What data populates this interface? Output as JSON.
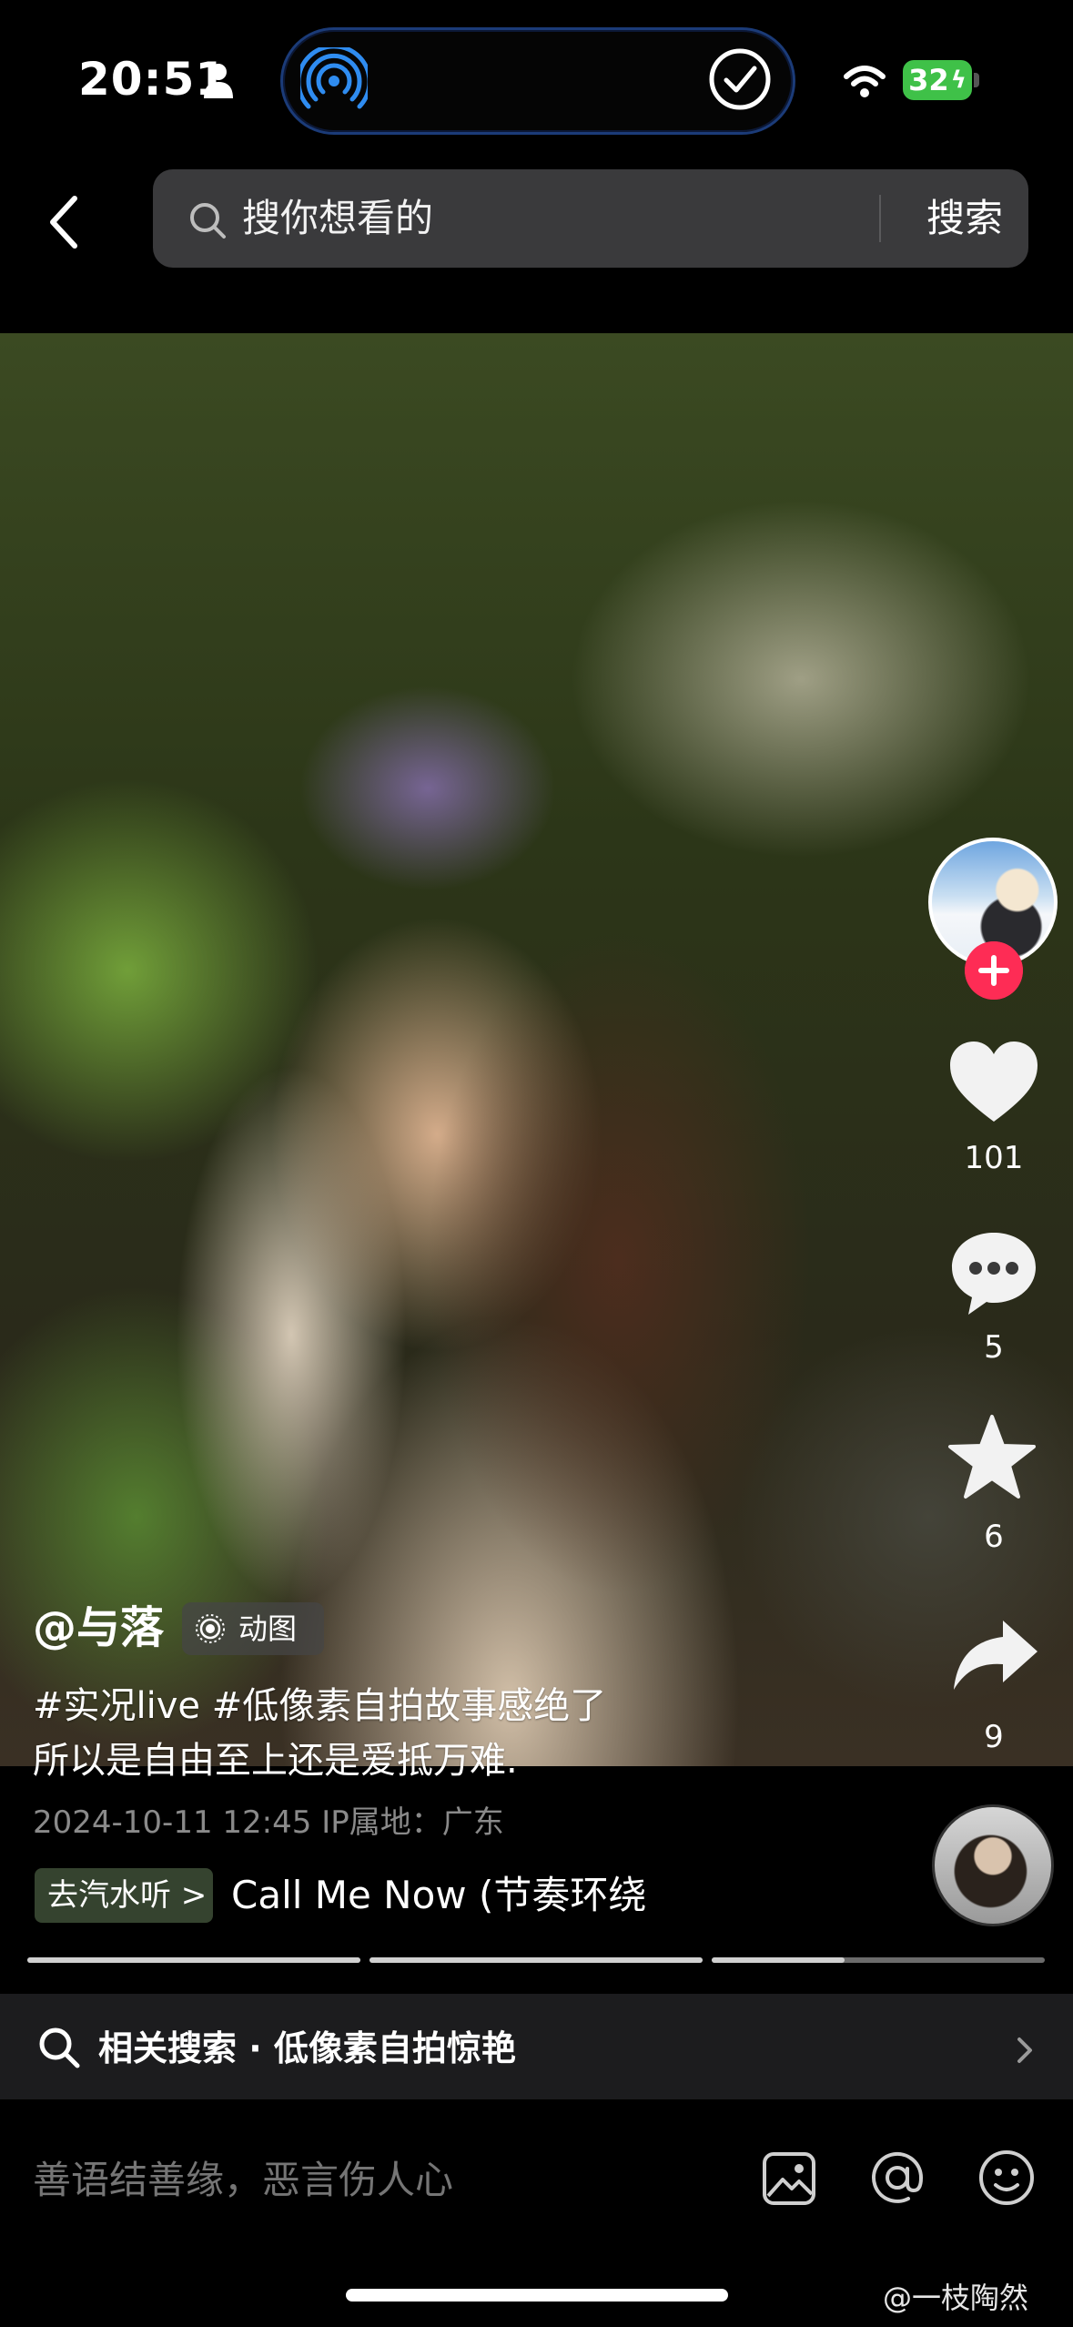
{
  "status_bar": {
    "time": "20:51",
    "battery": "32"
  },
  "header": {
    "search_placeholder": "搜你想看的",
    "search_button": "搜索"
  },
  "post": {
    "author": "@与落",
    "badge": "动图",
    "caption_line1": "#实况live #低像素自拍故事感绝了",
    "caption_line2": "所以是自由至上还是爱抵万难.",
    "meta": "2024-10-11 12:45   IP属地：广东"
  },
  "actions": {
    "likes": "101",
    "comments": "5",
    "favorites": "6",
    "shares": "9"
  },
  "music": {
    "badge": "去汽水听 >",
    "title": "Call Me Now (节奏环绕"
  },
  "progress": [
    1.0,
    1.0,
    0.4
  ],
  "related": {
    "text": "相关搜索 · 低像素自拍惊艳"
  },
  "comment": {
    "placeholder": "善语结善缘，恶言伤人心"
  },
  "watermark": "@一枝陶然",
  "colors": {
    "accent_red": "#fe2c55",
    "island_border": "#1b3b78",
    "battery_green": "#3fc148"
  }
}
